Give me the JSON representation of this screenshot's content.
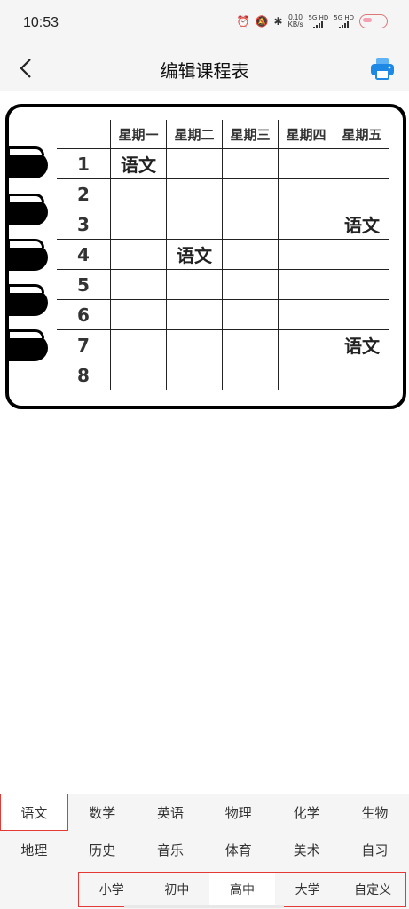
{
  "status_bar": {
    "time": "10:53",
    "net_speed_top": "0.10",
    "net_speed_bottom": "KB/s",
    "sig1": "5G HD",
    "sig2": "5G HD"
  },
  "header": {
    "title": "编辑课程表"
  },
  "schedule": {
    "days": [
      "星期一",
      "星期二",
      "星期三",
      "星期四",
      "星期五"
    ],
    "rows": [
      {
        "period": "1",
        "cells": [
          "语文",
          "",
          "",
          "",
          ""
        ]
      },
      {
        "period": "2",
        "cells": [
          "",
          "",
          "",
          "",
          ""
        ]
      },
      {
        "period": "3",
        "cells": [
          "",
          "",
          "",
          "",
          "语文"
        ]
      },
      {
        "period": "4",
        "cells": [
          "",
          "语文",
          "",
          "",
          ""
        ]
      },
      {
        "period": "5",
        "cells": [
          "",
          "",
          "",
          "",
          ""
        ]
      },
      {
        "period": "6",
        "cells": [
          "",
          "",
          "",
          "",
          ""
        ]
      },
      {
        "period": "7",
        "cells": [
          "",
          "",
          "",
          "",
          "语文"
        ]
      },
      {
        "period": "8",
        "cells": [
          "",
          "",
          "",
          "",
          ""
        ]
      }
    ]
  },
  "subjects": [
    "语文",
    "数学",
    "英语",
    "物理",
    "化学",
    "生物",
    "地理",
    "历史",
    "音乐",
    "体育",
    "美术",
    "自习"
  ],
  "levels": [
    "小学",
    "初中",
    "高中",
    "大学",
    "自定义"
  ],
  "colors": {
    "accent_red": "#e53935",
    "print_blue": "#1e88e5",
    "panel_bg": "#f5f5f5"
  }
}
